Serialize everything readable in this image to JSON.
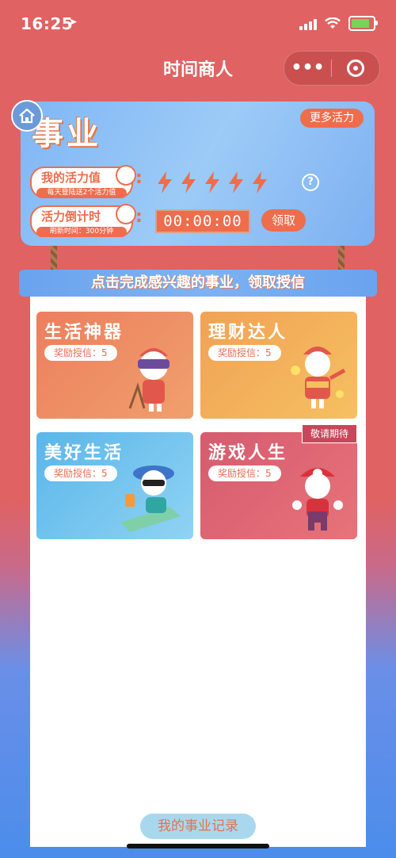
{
  "status_bar": {
    "time": "16:25"
  },
  "nav": {
    "title": "时间商人",
    "menu_glyph": "•••"
  },
  "career_board": {
    "title": "事业",
    "more_button": "更多活力",
    "vitality": {
      "label": "我的活力值",
      "sub": "每天登陆送2个活力值",
      "colon": ":",
      "bolts": 5,
      "help": "?"
    },
    "countdown": {
      "label": "活力倒计时",
      "sub": "刷新时间：300分钟",
      "colon": ":",
      "value": "00:00:00",
      "claim_button": "领取"
    }
  },
  "banner": {
    "text": "点击完成感兴趣的事业，领取授信"
  },
  "cards": [
    {
      "title": "生活神器",
      "reward": "奖励授信：5",
      "color": "#ec7e5e"
    },
    {
      "title": "理财达人",
      "reward": "奖励授信：5",
      "color": "#f2a24f"
    },
    {
      "title": "美好生活",
      "reward": "奖励授信：5",
      "color": "#6cc0ea"
    },
    {
      "title": "游戏人生",
      "reward": "奖励授信：5",
      "badge": "敬请期待",
      "color": "#d95c71"
    }
  ],
  "footer": {
    "record_button": "我的事业记录"
  },
  "colors": {
    "accent": "#ee6d4c",
    "board_blue": "#7fb6f5"
  }
}
